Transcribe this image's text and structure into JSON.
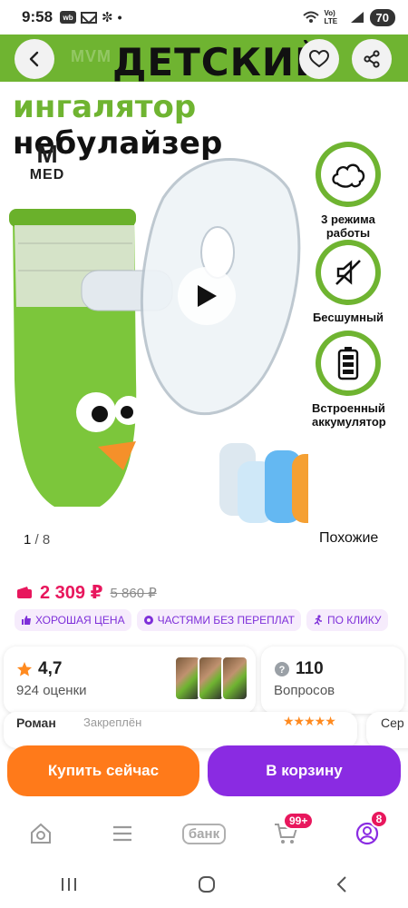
{
  "status_bar": {
    "time": "9:58",
    "icons": [
      "wb-icon",
      "mail-icon",
      "snowflake-icon",
      "dot"
    ],
    "network": "Vo) LTE",
    "battery": "70"
  },
  "hero": {
    "title_line1": "ДЕТСКИЙ",
    "title_line2_green": "ингалятор",
    "title_line2_black": "небулайзер",
    "faded_text": "MVM",
    "logo_text": "MED",
    "logo_mark": "M",
    "features": [
      {
        "icon": "cloud-icon",
        "label": "3 режима работы"
      },
      {
        "icon": "mute-icon",
        "label": "Бесшумный"
      },
      {
        "icon": "battery-icon",
        "label": "Встроенный аккумулятор"
      }
    ],
    "pager_current": "1",
    "pager_total": "/ 8",
    "similar_label": "Похожие"
  },
  "price": {
    "current": "2 309 ₽",
    "old": "5 860 ₽"
  },
  "chips": [
    {
      "icon": "thumbs-up-icon",
      "label": "ХОРОШАЯ ЦЕНА"
    },
    {
      "icon": "installments-icon",
      "label": "ЧАСТЯМИ БЕЗ ПЕРЕПЛАТ"
    },
    {
      "icon": "running-icon",
      "label": "ПО КЛИКУ"
    }
  ],
  "rating": {
    "value": "4,7",
    "count": "924 оценки"
  },
  "questions": {
    "value": "110",
    "label": "Вопросов"
  },
  "reviews_peek": {
    "author": "Роман",
    "pinned": "Закреплён",
    "next": "Сер"
  },
  "actions": {
    "buy": "Купить сейчас",
    "cart": "В корзину"
  },
  "bottom_nav": {
    "bank": "банк",
    "cart_badge": "99+",
    "profile_badge": "8"
  },
  "colors": {
    "brand_green": "#6fb431",
    "price_pink": "#e8175d",
    "chip_purple": "#7e2fd9",
    "buy_orange": "#ff7a1a",
    "cart_purple": "#8a2be2"
  }
}
